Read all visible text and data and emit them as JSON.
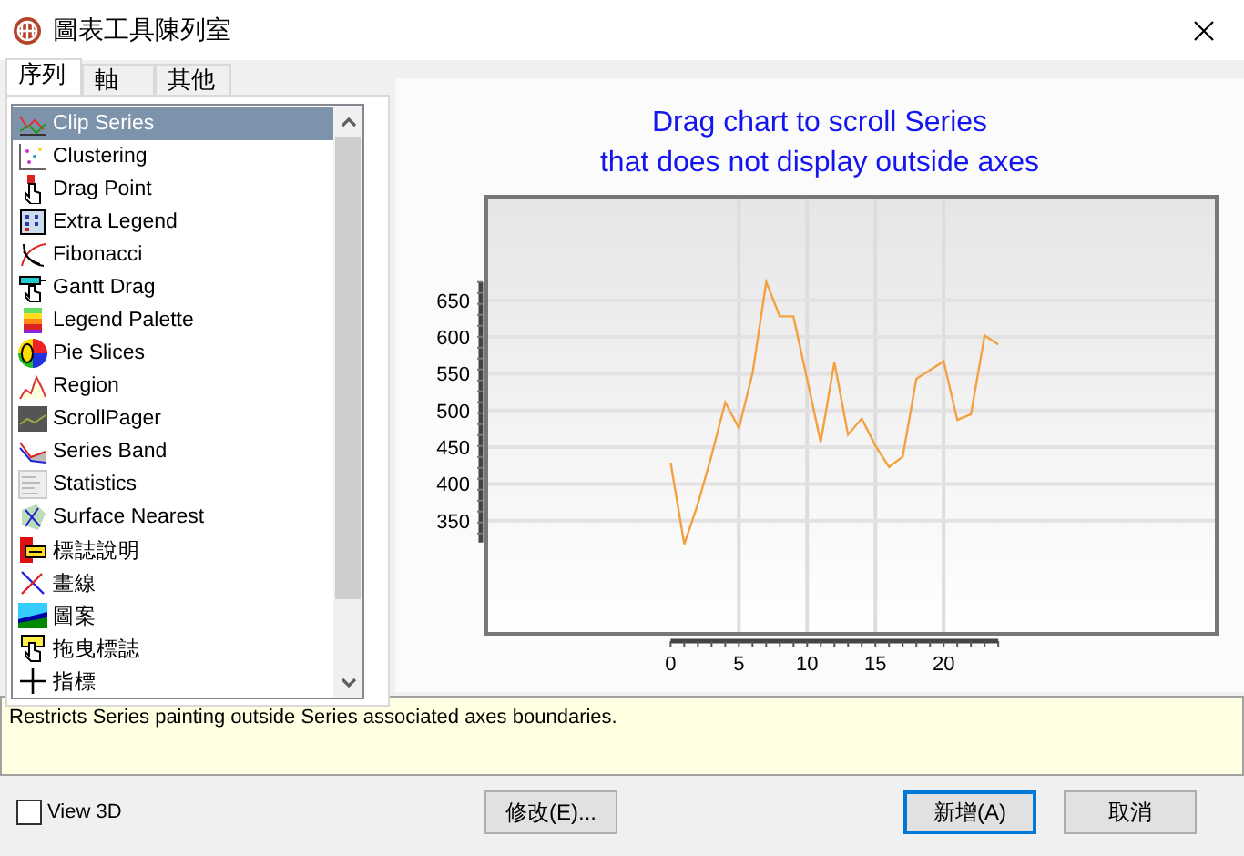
{
  "window": {
    "title": "圖表工具陳列室"
  },
  "tabs": [
    {
      "label": "序列",
      "selected": true
    },
    {
      "label": "軸",
      "selected": false
    },
    {
      "label": "其他",
      "selected": false
    }
  ],
  "series_list": {
    "items": [
      {
        "label": "Clip Series",
        "selected": true
      },
      {
        "label": "Clustering",
        "selected": false
      },
      {
        "label": "Drag Point",
        "selected": false
      },
      {
        "label": "Extra Legend",
        "selected": false
      },
      {
        "label": "Fibonacci",
        "selected": false
      },
      {
        "label": "Gantt Drag",
        "selected": false
      },
      {
        "label": "Legend Palette",
        "selected": false
      },
      {
        "label": "Pie Slices",
        "selected": false
      },
      {
        "label": "Region",
        "selected": false
      },
      {
        "label": "ScrollPager",
        "selected": false
      },
      {
        "label": "Series Band",
        "selected": false
      },
      {
        "label": "Statistics",
        "selected": false
      },
      {
        "label": "Surface Nearest",
        "selected": false
      },
      {
        "label": "標誌說明",
        "selected": false
      },
      {
        "label": "畫線",
        "selected": false
      },
      {
        "label": "圖案",
        "selected": false
      },
      {
        "label": "拖曳標誌",
        "selected": false
      },
      {
        "label": "指標",
        "selected": false
      }
    ]
  },
  "chart": {
    "title_lines": [
      "Drag chart to scroll Series",
      "that does not display outside axes"
    ],
    "chart_data": {
      "type": "line",
      "x": [
        0,
        1,
        2,
        3,
        4,
        5,
        6,
        7,
        8,
        9,
        10,
        11,
        12,
        13,
        14,
        15,
        16,
        17,
        18,
        19,
        20,
        21,
        22,
        23,
        24
      ],
      "grid": true,
      "series": [
        {
          "color": "#f4a040",
          "values": [
            429,
            318,
            373,
            439,
            511,
            476,
            551,
            675,
            628,
            628,
            543,
            457,
            566,
            467,
            489,
            452,
            423,
            437,
            543,
            555,
            567,
            487,
            495,
            602,
            590
          ]
        }
      ],
      "xlim": [
        -13.5,
        40
      ],
      "ylim": [
        196,
        791
      ],
      "xticks": [
        0,
        5,
        10,
        15,
        20
      ],
      "yticks": [
        350,
        400,
        450,
        500,
        550,
        600,
        650
      ]
    }
  },
  "description": "Restricts Series painting outside Series associated axes boundaries.",
  "view_3d": {
    "label": "View 3D",
    "checked": false
  },
  "buttons": [
    {
      "label": "修改(E)...",
      "default": false
    },
    {
      "label": "新增(A)",
      "default": true
    },
    {
      "label": "取消",
      "default": false
    }
  ]
}
